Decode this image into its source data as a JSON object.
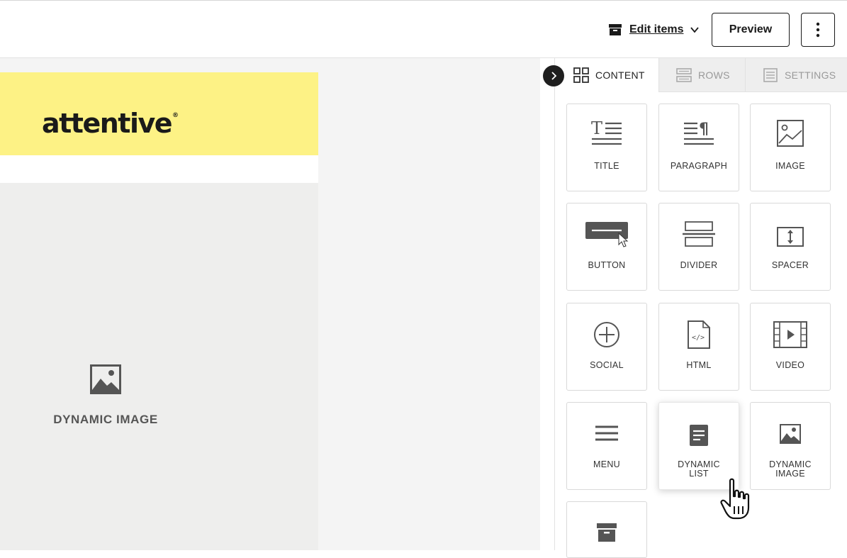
{
  "topbar": {
    "edit_items_label": "Edit items",
    "preview_label": "Preview"
  },
  "canvas": {
    "brand_logo_text": "attentive",
    "brand_logo_mark": "®",
    "dynamic_image_label": "DYNAMIC IMAGE"
  },
  "panel": {
    "tabs": [
      {
        "label": "CONTENT",
        "icon": "grid-icon",
        "active": true
      },
      {
        "label": "ROWS",
        "icon": "rows-icon",
        "active": false
      },
      {
        "label": "SETTINGS",
        "icon": "settings-doc-icon",
        "active": false
      }
    ],
    "tiles": [
      {
        "label": "TITLE",
        "icon": "title-icon"
      },
      {
        "label": "PARAGRAPH",
        "icon": "paragraph-icon"
      },
      {
        "label": "IMAGE",
        "icon": "image-icon"
      },
      {
        "label": "BUTTON",
        "icon": "button-icon"
      },
      {
        "label": "DIVIDER",
        "icon": "divider-icon"
      },
      {
        "label": "SPACER",
        "icon": "spacer-icon"
      },
      {
        "label": "SOCIAL",
        "icon": "social-icon"
      },
      {
        "label": "HTML",
        "icon": "html-icon"
      },
      {
        "label": "VIDEO",
        "icon": "video-icon"
      },
      {
        "label": "MENU",
        "icon": "menu-icon"
      },
      {
        "label_line1": "DYNAMIC",
        "label_line2": "LIST",
        "icon": "dynamic-list-icon"
      },
      {
        "label_line1": "DYNAMIC",
        "label_line2": "IMAGE",
        "icon": "dynamic-image-icon"
      },
      {
        "label": "",
        "icon": "box-icon"
      }
    ]
  },
  "colors": {
    "header_yellow": "#fdf285",
    "icon_gray": "#555555",
    "dark": "#1f1f1f"
  }
}
